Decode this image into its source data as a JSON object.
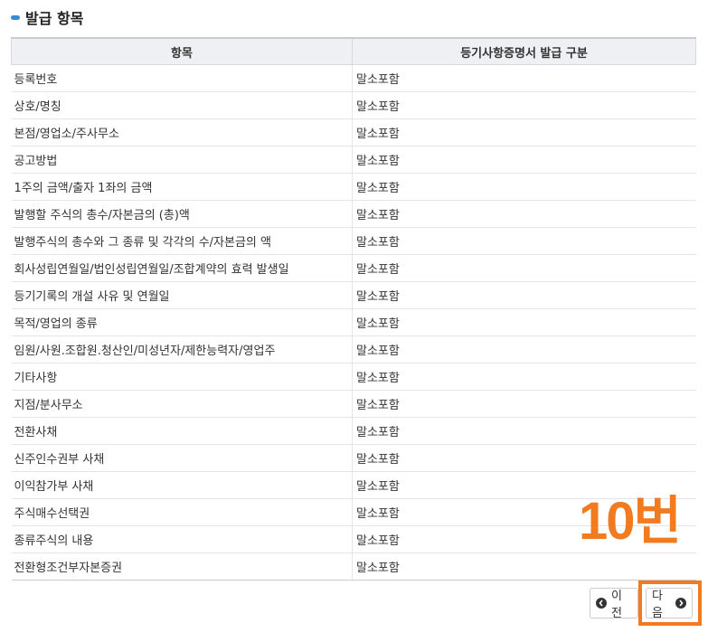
{
  "section": {
    "title": "발급 항목"
  },
  "table": {
    "headers": [
      "항목",
      "등기사항증명서 발급 구분"
    ],
    "rows": [
      {
        "item": "등록번호",
        "value": "말소포함"
      },
      {
        "item": "상호/명칭",
        "value": "말소포함"
      },
      {
        "item": "본점/영업소/주사무소",
        "value": "말소포함"
      },
      {
        "item": "공고방법",
        "value": "말소포함"
      },
      {
        "item": "1주의 금액/출자 1좌의 금액",
        "value": "말소포함"
      },
      {
        "item": "발행할 주식의 총수/자본금의 (총)액",
        "value": "말소포함"
      },
      {
        "item": "발행주식의 총수와 그 종류 및 각각의 수/자본금의 액",
        "value": "말소포함"
      },
      {
        "item": "회사성립연월일/법인성립연월일/조합계약의 효력 발생일",
        "value": "말소포함"
      },
      {
        "item": "등기기록의 개설 사유 및 연월일",
        "value": "말소포함"
      },
      {
        "item": "목적/영업의 종류",
        "value": "말소포함"
      },
      {
        "item": "임원/사원.조합원.청산인/미성년자/제한능력자/영업주",
        "value": "말소포함"
      },
      {
        "item": "기타사항",
        "value": "말소포함"
      },
      {
        "item": "지점/분사무소",
        "value": "말소포함"
      },
      {
        "item": "전환사채",
        "value": "말소포함"
      },
      {
        "item": "신주인수권부 사채",
        "value": "말소포함"
      },
      {
        "item": "이익참가부 사채",
        "value": "말소포함"
      },
      {
        "item": "주식매수선택권",
        "value": "말소포함"
      },
      {
        "item": "종류주식의 내용",
        "value": "말소포함"
      },
      {
        "item": "전환형조건부자본증권",
        "value": "말소포함"
      }
    ]
  },
  "annotation": {
    "label": "10번",
    "color": "#f27a1f"
  },
  "pager": {
    "prev_label": "이전",
    "next_label": "다음",
    "prev_icon": "circle-chevron-left-icon",
    "next_icon": "circle-chevron-right-icon"
  },
  "colors": {
    "accent": "#3b8ad8",
    "header_bg": "#eef0f3",
    "highlight": "#f27a1f"
  }
}
